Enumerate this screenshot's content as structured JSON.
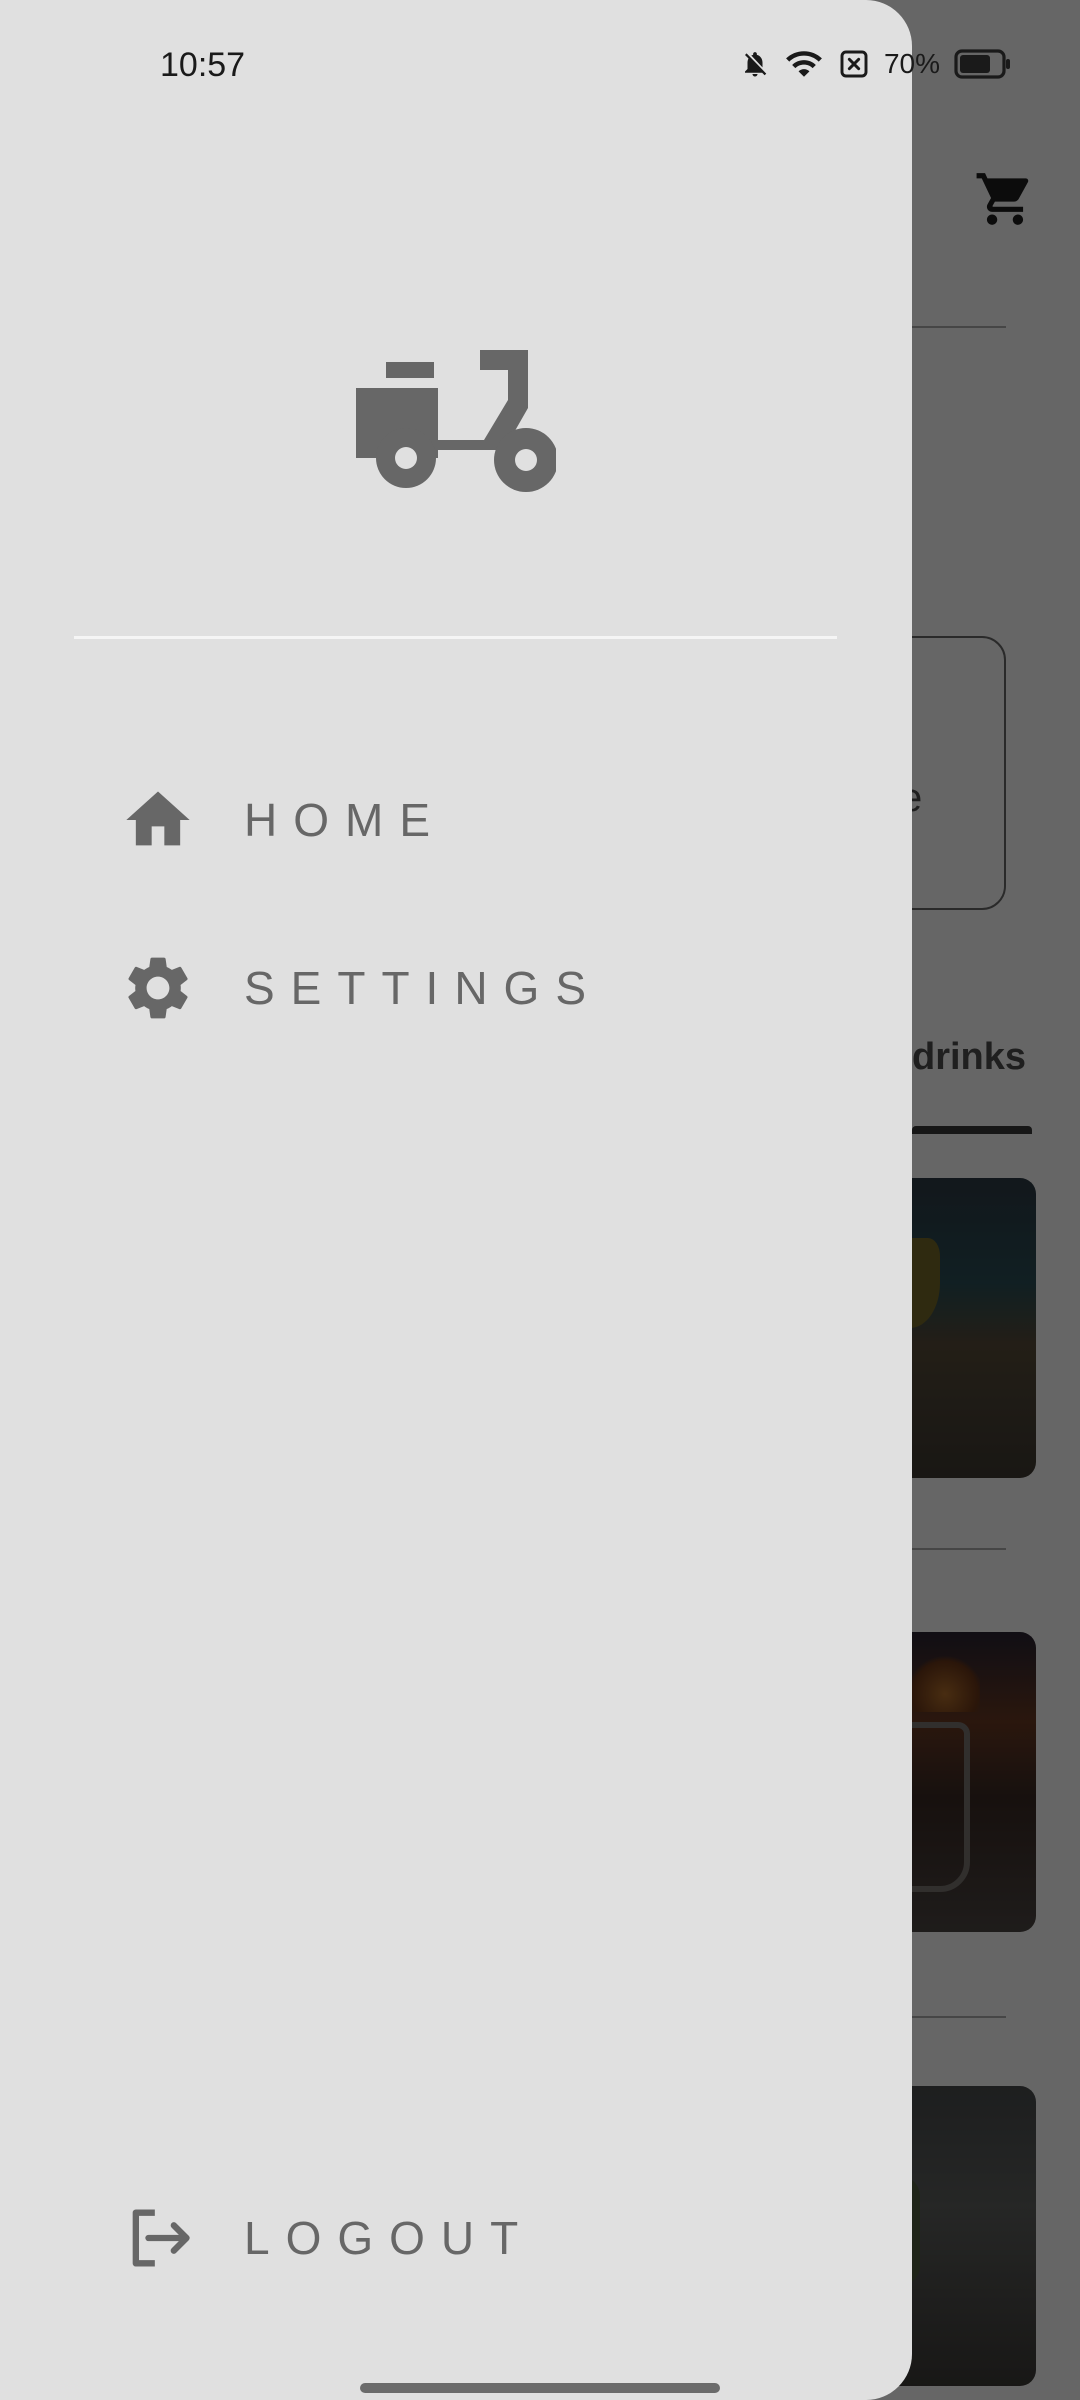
{
  "status_bar": {
    "time": "10:57",
    "battery_percent": "70%",
    "icons": [
      "bell-off-icon",
      "wifi-icon",
      "no-sim-icon",
      "battery-icon"
    ]
  },
  "background_app": {
    "search_placeholder_fragment": "e",
    "tab_label_fragment": "drinks",
    "icons": [
      "cart-icon"
    ]
  },
  "drawer": {
    "logo_icon": "scooter-icon",
    "items": [
      {
        "label": "HOME",
        "icon": "home-icon"
      },
      {
        "label": "SETTINGS",
        "icon": "gear-icon"
      }
    ],
    "logout": {
      "label": "LOGOUT",
      "icon": "logout-icon"
    }
  },
  "colors": {
    "drawer_background": "#e0e0e0",
    "icon_gray": "#676767",
    "scrim": "rgba(0,0,0,0.6)"
  }
}
